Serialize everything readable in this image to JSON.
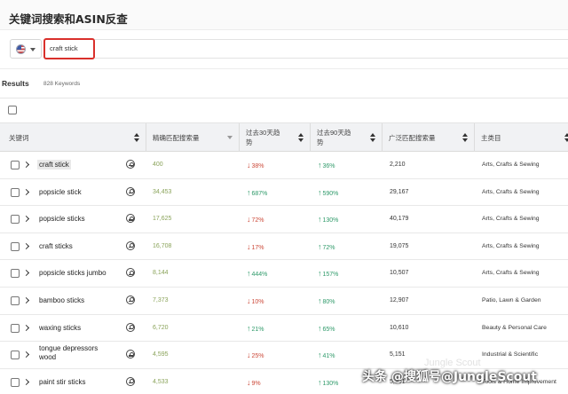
{
  "header": {
    "title": "关键词搜索和ASIN反查"
  },
  "search": {
    "query": "craft stick"
  },
  "results": {
    "label": "Results",
    "count": "828 Keywords"
  },
  "columns": {
    "keyword": "关键词",
    "exact": "精确匹配搜索量",
    "trend30": "过去30天趋势",
    "trend90": "过去90天趋势",
    "broad": "广泛匹配搜索量",
    "category": "主类目"
  },
  "rows": [
    {
      "keyword": "craft stick",
      "exact": "400",
      "t30_dir": "down",
      "t30": "38%",
      "t90_dir": "up",
      "t90": "36%",
      "broad": "2,210",
      "category": "Arts, Crafts & Sewing"
    },
    {
      "keyword": "popsicle stick",
      "exact": "34,453",
      "t30_dir": "up",
      "t30": "687%",
      "t90_dir": "up",
      "t90": "590%",
      "broad": "29,167",
      "category": "Arts, Crafts & Sewing"
    },
    {
      "keyword": "popsicle sticks",
      "exact": "17,625",
      "t30_dir": "down",
      "t30": "72%",
      "t90_dir": "up",
      "t90": "130%",
      "broad": "40,179",
      "category": "Arts, Crafts & Sewing"
    },
    {
      "keyword": "craft sticks",
      "exact": "16,708",
      "t30_dir": "down",
      "t30": "17%",
      "t90_dir": "up",
      "t90": "72%",
      "broad": "19,075",
      "category": "Arts, Crafts & Sewing"
    },
    {
      "keyword": "popsicle sticks jumbo",
      "exact": "8,144",
      "t30_dir": "up",
      "t30": "444%",
      "t90_dir": "up",
      "t90": "157%",
      "broad": "10,507",
      "category": "Arts, Crafts & Sewing"
    },
    {
      "keyword": "bamboo sticks",
      "exact": "7,373",
      "t30_dir": "down",
      "t30": "10%",
      "t90_dir": "up",
      "t90": "80%",
      "broad": "12,907",
      "category": "Patio, Lawn & Garden"
    },
    {
      "keyword": "waxing sticks",
      "exact": "6,720",
      "t30_dir": "up",
      "t30": "21%",
      "t90_dir": "up",
      "t90": "65%",
      "broad": "10,610",
      "category": "Beauty & Personal Care"
    },
    {
      "keyword": "tongue depressors wood",
      "exact": "4,595",
      "t30_dir": "down",
      "t30": "25%",
      "t90_dir": "up",
      "t90": "41%",
      "broad": "5,151",
      "category": "Industrial & Scientific"
    },
    {
      "keyword": "paint stir sticks",
      "exact": "4,533",
      "t30_dir": "down",
      "t30": "9%",
      "t90_dir": "up",
      "t90": "130%",
      "broad": "5,331",
      "category": "Tools & Home Improvement"
    }
  ],
  "watermark": {
    "text": "头条 @搜狐号@JungleScout",
    "text_en": "Jungle Scout"
  },
  "colors": {
    "search_border": "#d9302b",
    "up": "#2f9a6a",
    "down": "#cc4a3a",
    "exact_value": "#8aa35a"
  },
  "icons": {
    "coin": "dollar-coin-icon",
    "expand": "chevron-right-icon",
    "sort": "sort-icon",
    "flag": "us-flag-icon"
  }
}
